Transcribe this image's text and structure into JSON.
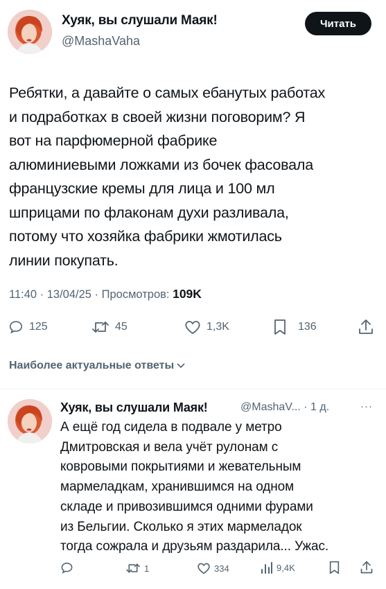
{
  "post": {
    "author_name": "Хуяк, вы слушали Маяк!",
    "author_handle": "@MashaVaha",
    "read_button": "Читать",
    "text": "Ребятки, а давайте о самых ебанутых работах\nи подработках в своей жизни поговорим? Я\nвот на парфюмерной фабрике\nалюминиевыми ложками из бочек фасовала\nфранцузские кремы для лица и 100 мл\nшприцами по флаконам духи разливала,\nпотому что хозяйка фабрики жмотилась\nлинии покупать.",
    "timestamp": "11:40 · 13/04/25 · Просмотров: ",
    "views": "109K",
    "stats": {
      "replies": "125",
      "reposts": "45",
      "likes": "1,3K",
      "bookmarks": "136"
    }
  },
  "replies_header": "Наиболее актуальные ответы",
  "reply": {
    "author_name": "Хуяк, вы слушали Маяк!",
    "handle_time": "@MashaV... · 1 д.",
    "more": "···",
    "text": "А ещё год сидела в подвале у метро\nДмитровская и вела учёт рулонам с\nковровыми покрытиями и жевательным\nмармеладкам, хранившимся на одном\nскладе и привозившимся одними фурами\nиз Бельгии. Сколько я этих мармеладок\nтогда сожрала и друзьям раздарила... Ужас.",
    "stats": {
      "reposts": "1",
      "likes": "334",
      "views": "9,4K"
    }
  },
  "colors": {
    "text": "#0f1419",
    "secondary": "#536471",
    "button_bg": "#0f1419"
  }
}
